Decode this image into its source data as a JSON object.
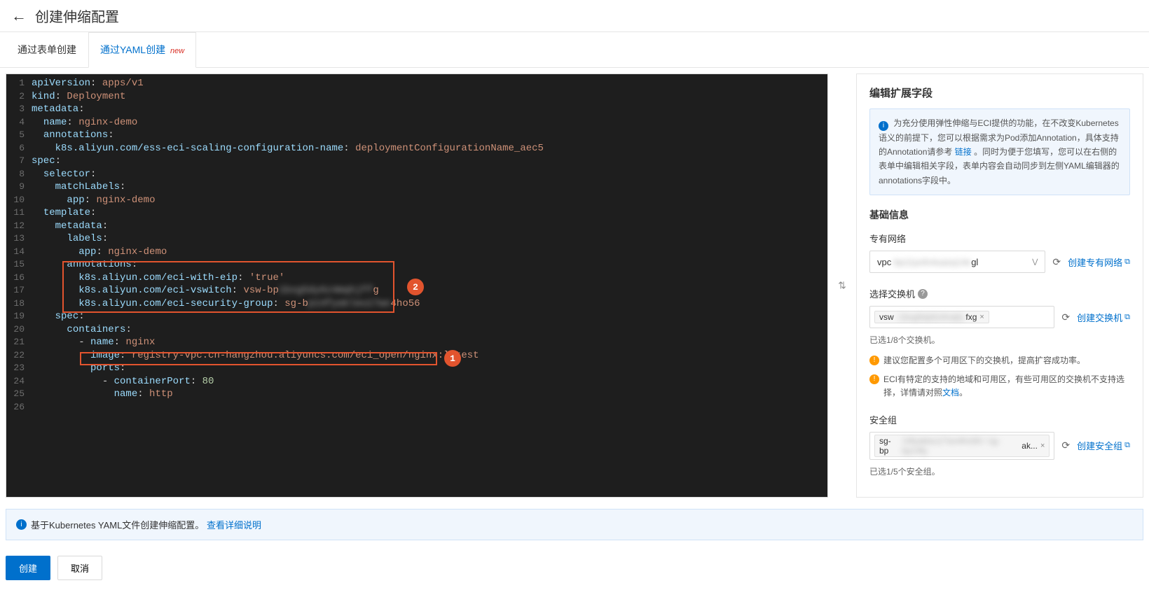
{
  "header": {
    "title": "创建伸缩配置"
  },
  "tabs": {
    "form": "通过表单创建",
    "yaml": "通过YAML创建",
    "new_badge": "new"
  },
  "code": {
    "lines": [
      [
        {
          "t": "apiVersion",
          "c": "key"
        },
        {
          "t": ": ",
          "c": "c"
        },
        {
          "t": "apps/v1",
          "c": "v"
        }
      ],
      [
        {
          "t": "kind",
          "c": "key"
        },
        {
          "t": ": ",
          "c": "c"
        },
        {
          "t": "Deployment",
          "c": "v"
        }
      ],
      [
        {
          "t": "metadata",
          "c": "key"
        },
        {
          "t": ":",
          "c": "c"
        }
      ],
      [
        {
          "t": "  ",
          "c": "c"
        },
        {
          "t": "name",
          "c": "key"
        },
        {
          "t": ": ",
          "c": "c"
        },
        {
          "t": "nginx-demo",
          "c": "v"
        }
      ],
      [
        {
          "t": "  ",
          "c": "c"
        },
        {
          "t": "annotations",
          "c": "key"
        },
        {
          "t": ":",
          "c": "c"
        }
      ],
      [
        {
          "t": "    ",
          "c": "c"
        },
        {
          "t": "k8s.aliyun.com/ess-eci-scaling-configuration-name",
          "c": "key"
        },
        {
          "t": ": ",
          "c": "c"
        },
        {
          "t": "deploymentConfigurationName_aec5",
          "c": "v"
        }
      ],
      [
        {
          "t": "spec",
          "c": "key"
        },
        {
          "t": ":",
          "c": "c"
        }
      ],
      [
        {
          "t": "  ",
          "c": "c"
        },
        {
          "t": "selector",
          "c": "key"
        },
        {
          "t": ":",
          "c": "c"
        }
      ],
      [
        {
          "t": "    ",
          "c": "c"
        },
        {
          "t": "matchLabels",
          "c": "key"
        },
        {
          "t": ":",
          "c": "c"
        }
      ],
      [
        {
          "t": "      ",
          "c": "c"
        },
        {
          "t": "app",
          "c": "key"
        },
        {
          "t": ": ",
          "c": "c"
        },
        {
          "t": "nginx-demo",
          "c": "v"
        }
      ],
      [
        {
          "t": "  ",
          "c": "c"
        },
        {
          "t": "template",
          "c": "key"
        },
        {
          "t": ":",
          "c": "c"
        }
      ],
      [
        {
          "t": "    ",
          "c": "c"
        },
        {
          "t": "metadata",
          "c": "key"
        },
        {
          "t": ":",
          "c": "c"
        }
      ],
      [
        {
          "t": "      ",
          "c": "c"
        },
        {
          "t": "labels",
          "c": "key"
        },
        {
          "t": ":",
          "c": "c"
        }
      ],
      [
        {
          "t": "        ",
          "c": "c"
        },
        {
          "t": "app",
          "c": "key"
        },
        {
          "t": ": ",
          "c": "c"
        },
        {
          "t": "nginx-demo",
          "c": "v"
        }
      ],
      [
        {
          "t": "      ",
          "c": "c"
        },
        {
          "t": "annotations",
          "c": "key"
        },
        {
          "t": ":",
          "c": "c"
        }
      ],
      [
        {
          "t": "        ",
          "c": "c"
        },
        {
          "t": "k8s.aliyun.com/eci-with-eip",
          "c": "key"
        },
        {
          "t": ": ",
          "c": "c"
        },
        {
          "t": "'true'",
          "c": "v"
        }
      ],
      [
        {
          "t": "        ",
          "c": "c"
        },
        {
          "t": "k8s.aliyun.com/eci-vswitch",
          "c": "key"
        },
        {
          "t": ": ",
          "c": "c"
        },
        {
          "t": "vsw-bp",
          "c": "v"
        },
        {
          "t": "1bxg5dy6z4mqhjff",
          "c": "v",
          "blur": true
        },
        {
          "t": "g",
          "c": "v"
        }
      ],
      [
        {
          "t": "        ",
          "c": "c"
        },
        {
          "t": "k8s.aliyun.com/eci-security-group",
          "c": "key"
        },
        {
          "t": ": ",
          "c": "c"
        },
        {
          "t": "sg-b",
          "c": "v"
        },
        {
          "t": "p14fyakleu17wo",
          "c": "v",
          "blur": true
        },
        {
          "t": "4ho56",
          "c": "v"
        }
      ],
      [
        {
          "t": "    ",
          "c": "c"
        },
        {
          "t": "spec",
          "c": "key"
        },
        {
          "t": ":",
          "c": "c"
        }
      ],
      [
        {
          "t": "      ",
          "c": "c"
        },
        {
          "t": "containers",
          "c": "key"
        },
        {
          "t": ":",
          "c": "c"
        }
      ],
      [
        {
          "t": "        - ",
          "c": "c"
        },
        {
          "t": "name",
          "c": "key"
        },
        {
          "t": ": ",
          "c": "c"
        },
        {
          "t": "nginx",
          "c": "v"
        }
      ],
      [
        {
          "t": "          ",
          "c": "c"
        },
        {
          "t": "image",
          "c": "key"
        },
        {
          "t": ": ",
          "c": "c"
        },
        {
          "t": "registry-vpc.cn-hangzhou.aliyuncs.com/eci_open/nginx:latest",
          "c": "v"
        }
      ],
      [
        {
          "t": "          ",
          "c": "c"
        },
        {
          "t": "ports",
          "c": "key"
        },
        {
          "t": ":",
          "c": "c"
        }
      ],
      [
        {
          "t": "            - ",
          "c": "c"
        },
        {
          "t": "containerPort",
          "c": "key"
        },
        {
          "t": ": ",
          "c": "c"
        },
        {
          "t": "80",
          "c": "n"
        }
      ],
      [
        {
          "t": "              ",
          "c": "c"
        },
        {
          "t": "name",
          "c": "key"
        },
        {
          "t": ": ",
          "c": "c"
        },
        {
          "t": "http",
          "c": "v"
        }
      ],
      []
    ],
    "annotations": {
      "badge1": "1",
      "badge2": "2"
    }
  },
  "panel": {
    "title": "编辑扩展字段",
    "info": {
      "pre": "为充分使用弹性伸缩与ECI提供的功能，在不改变Kubernetes语义的前提下，您可以根据需求为Pod添加Annotation，具体支持的Annotation请参考 ",
      "link": "链接",
      "post": "。同时为便于您填写，您可以在右侧的表单中编辑相关字段，表单内容会自动同步到左侧YAML编辑器的annotations字段中。"
    },
    "basic_title": "基础信息",
    "vpc": {
      "label": "专有网络",
      "value_prefix": "vpc",
      "value_blur": "-bp11pxfo4uasq14e",
      "value_suffix": "gl",
      "create": "创建专有网络"
    },
    "vswitch": {
      "label": "选择交换机",
      "tag_prefix": "vsw",
      "tag_blur": "-1bxg5dy6z4mqhj",
      "tag_suffix": "fxg",
      "create": "创建交换机",
      "selected": "已选1/8个交换机。",
      "warn1": "建议您配置多个可用区下的交换机，提高扩容成功率。",
      "warn2_pre": "ECI有特定的支持的地域和可用区，有些可用区的交换机不支持选择，详情请对照",
      "warn2_link": "文档",
      "warn2_post": "。"
    },
    "sg": {
      "label": "安全组",
      "tag_prefix": "sg-bp",
      "tag_blur": "14fyakleu17wo4ho56 / sg-bp14fy",
      "tag_suffix": "ak...",
      "create": "创建安全组",
      "selected": "已选1/5个安全组。"
    }
  },
  "footer": {
    "text": "基于Kubernetes YAML文件创建伸缩配置。",
    "link": "查看详细说明"
  },
  "actions": {
    "create": "创建",
    "cancel": "取消"
  }
}
